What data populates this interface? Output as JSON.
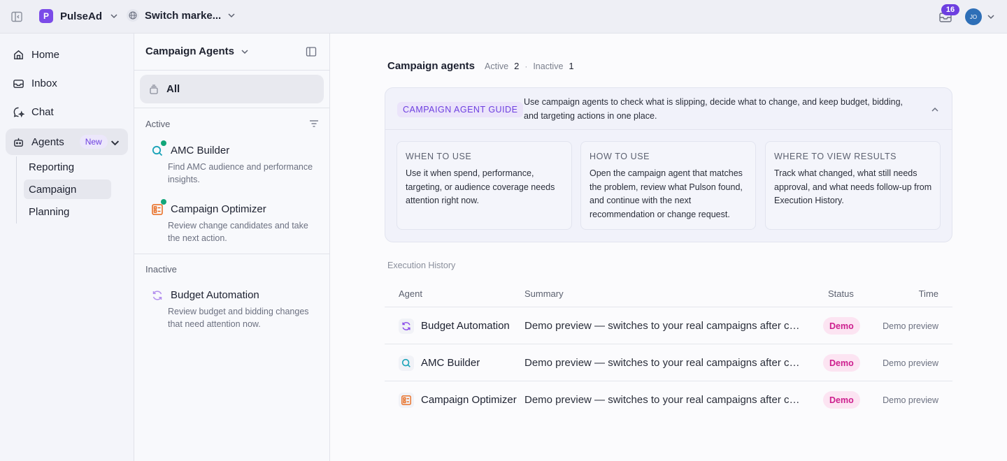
{
  "topbar": {
    "brand_initial": "P",
    "brand_name": "PulseAd",
    "market_label": "Switch marke...",
    "inbox_count": "16",
    "avatar_initials": "JO"
  },
  "nav": {
    "home": "Home",
    "inbox": "Inbox",
    "chat": "Chat",
    "agents": "Agents",
    "agents_badge": "New",
    "sub": [
      "Reporting",
      "Campaign",
      "Planning"
    ]
  },
  "agent_panel": {
    "title": "Campaign Agents",
    "all_label": "All",
    "active_section": "Active",
    "inactive_section": "Inactive",
    "agents": [
      {
        "name": "AMC Builder",
        "desc": "Find AMC audience and performance insights.",
        "icon": "search-icon",
        "status": "active"
      },
      {
        "name": "Campaign Optimizer",
        "desc": "Review change candidates and take the next action.",
        "icon": "list-icon",
        "status": "active"
      },
      {
        "name": "Budget Automation",
        "desc": "Review budget and bidding changes that need attention now.",
        "icon": "refresh-icon",
        "status": "inactive"
      }
    ]
  },
  "main": {
    "title": "Campaign agents",
    "active_label": "Active",
    "active_count": "2",
    "inactive_label": "Inactive",
    "inactive_count": "1",
    "guide": {
      "tag": "CAMPAIGN AGENT GUIDE",
      "text": "Use campaign agents to check what is slipping, decide what to change, and keep budget, bidding, and targeting actions in one place.",
      "cards": [
        {
          "heading": "WHEN TO USE",
          "body": "Use it when spend, performance, targeting, or audience coverage needs attention right now."
        },
        {
          "heading": "HOW TO USE",
          "body": "Open the campaign agent that matches the problem, review what Pulson found, and continue with the next recommendation or change request."
        },
        {
          "heading": "WHERE TO VIEW RESULTS",
          "body": "Track what changed, what still needs approval, and what needs follow-up from Execution History."
        }
      ]
    },
    "history": {
      "title": "Execution History",
      "columns": [
        "Agent",
        "Summary",
        "Status",
        "Time"
      ],
      "rows": [
        {
          "agent": "Budget Automation",
          "icon": "refresh-icon",
          "summary": "Demo preview — switches to your real campaigns after connecting",
          "status": "Demo",
          "time": "Demo preview"
        },
        {
          "agent": "AMC Builder",
          "icon": "search-icon",
          "summary": "Demo preview — switches to your real campaigns after connecting",
          "status": "Demo",
          "time": "Demo preview"
        },
        {
          "agent": "Campaign Optimizer",
          "icon": "list-icon",
          "summary": "Demo preview — switches to your real campaigns after connecting",
          "status": "Demo",
          "time": "Demo preview"
        }
      ]
    }
  },
  "colors": {
    "accent": "#6d3fe0",
    "active_dot": "#12a679",
    "demo_badge_bg": "#fce4f2",
    "demo_badge_text": "#cd1f8e",
    "search_icon": "#1aa3b8",
    "optimizer_icon": "#e8681a",
    "automation_icon": "#8a4be8"
  }
}
